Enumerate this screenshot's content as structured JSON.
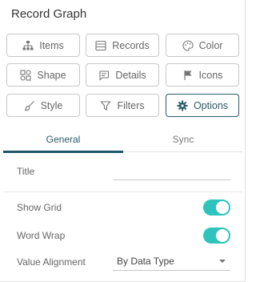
{
  "header": {
    "title": "Record Graph"
  },
  "buttons": {
    "items": "Items",
    "records": "Records",
    "color": "Color",
    "shape": "Shape",
    "details": "Details",
    "icons": "Icons",
    "style": "Style",
    "filters": "Filters",
    "options": "Options"
  },
  "icons": {
    "items": "hierarchy-icon",
    "records": "table-icon",
    "color": "palette-icon",
    "shape": "shapes-icon",
    "details": "comment-icon",
    "icons": "flag-icon",
    "style": "brush-icon",
    "filters": "funnel-icon",
    "options": "gear-icon"
  },
  "tabs": [
    {
      "label": "General",
      "active": true
    },
    {
      "label": "Sync",
      "active": false
    }
  ],
  "general": {
    "title_label": "Title",
    "title_value": "",
    "show_grid_label": "Show Grid",
    "show_grid": true,
    "word_wrap_label": "Word Wrap",
    "word_wrap": true,
    "value_alignment_label": "Value Alignment",
    "value_alignment": "By Data Type"
  },
  "colors": {
    "accent": "#1f5566",
    "toggle_on": "#2fc4bb",
    "border": "#c8c8c8"
  }
}
